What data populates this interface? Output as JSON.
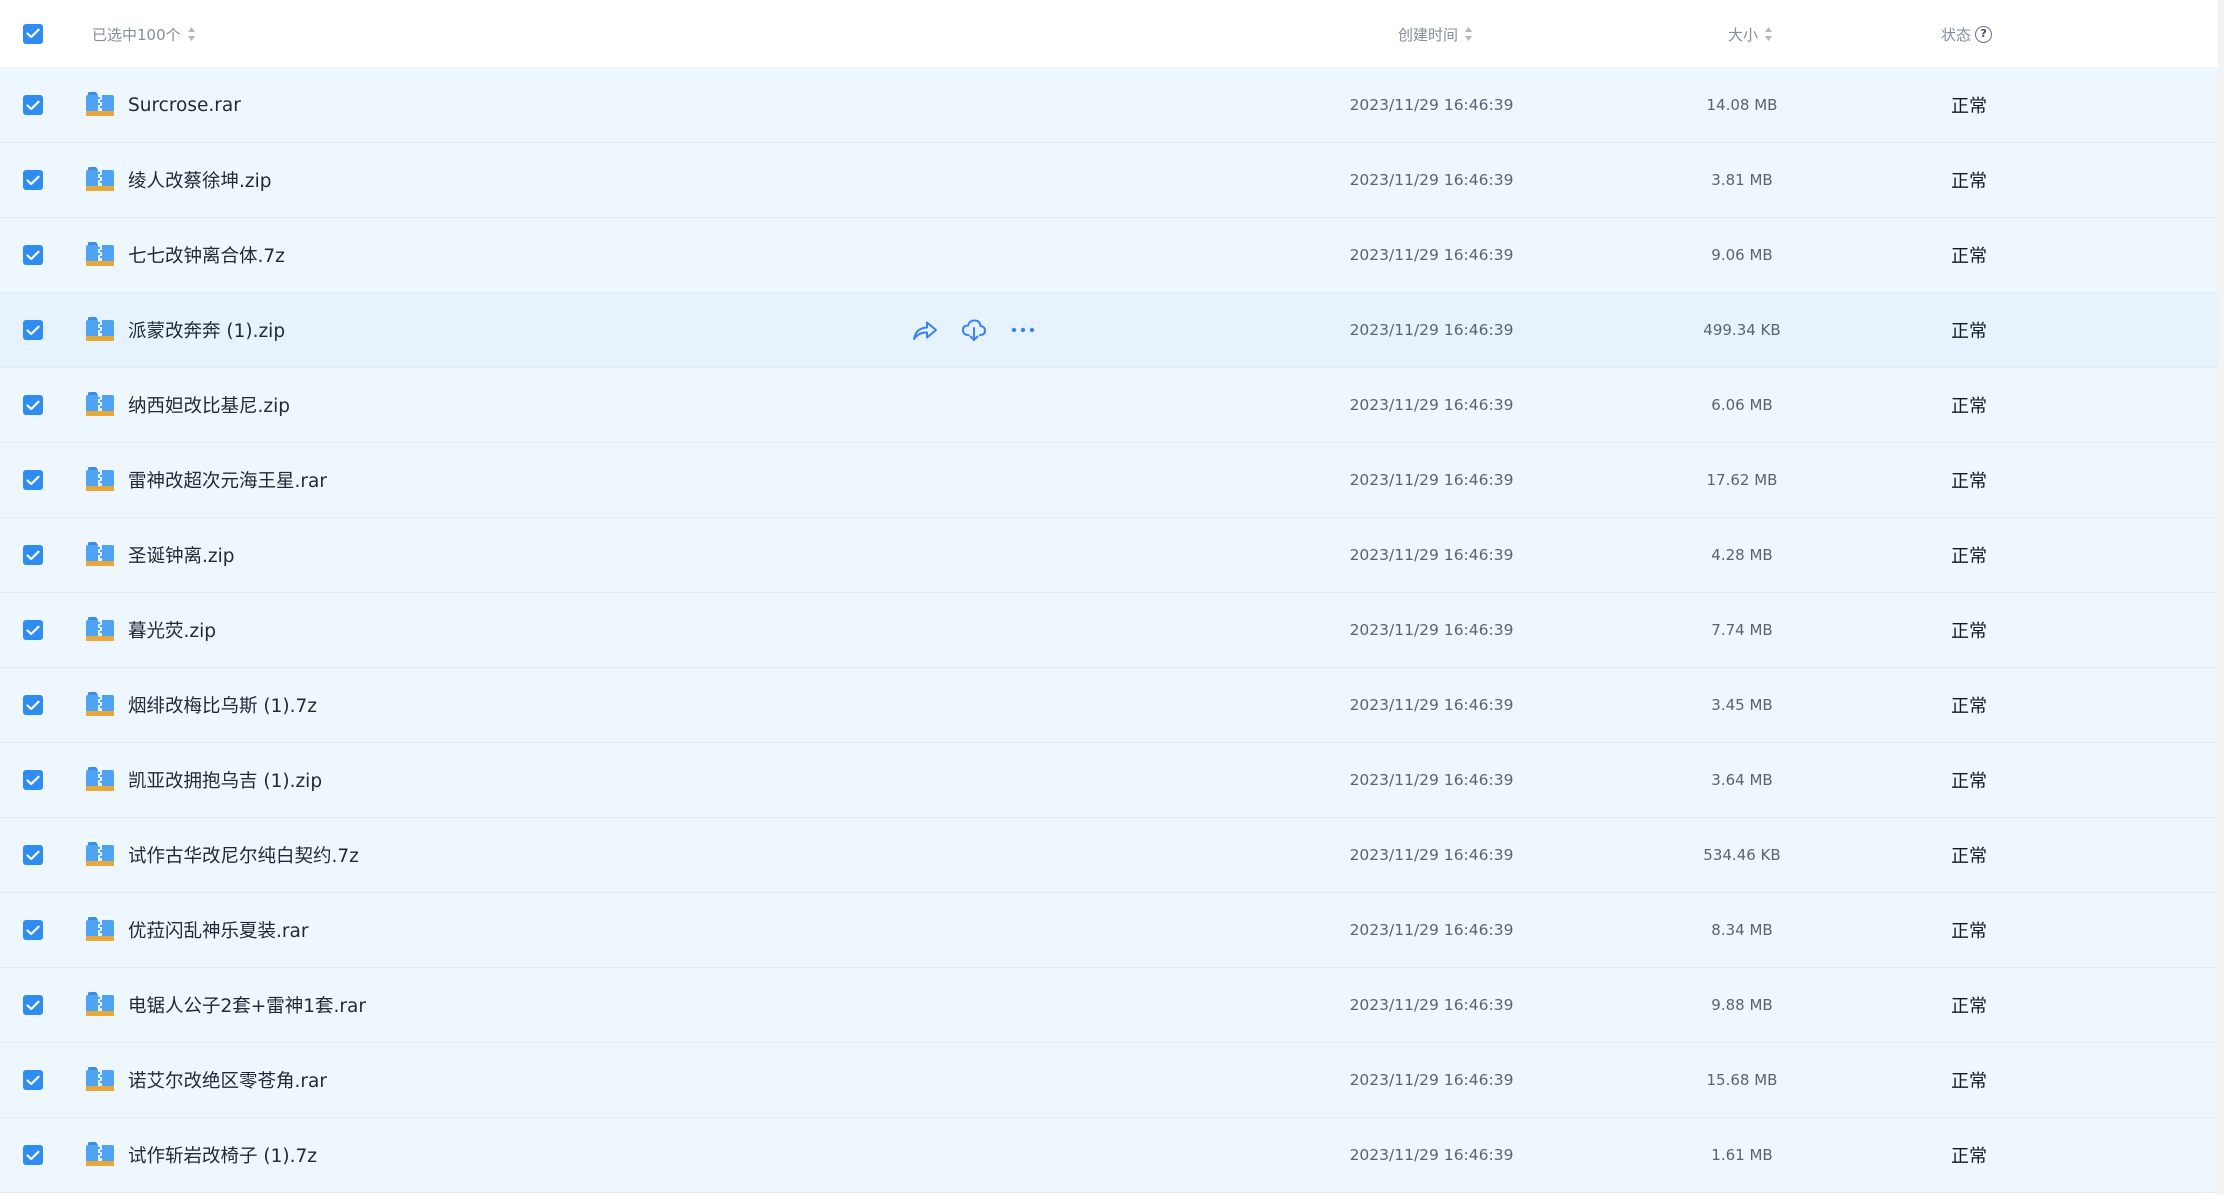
{
  "header": {
    "selected_label": "已选中100个",
    "date_label": "创建时间",
    "size_label": "大小",
    "status_label": "状态",
    "help_glyph": "?"
  },
  "colors": {
    "accent": "#2f8cf0",
    "row_bg": "#eff7fe",
    "row_hover_bg": "#e6f3fd"
  },
  "icons": {
    "file": "zip-archive-icon",
    "share": "share-icon",
    "download": "cloud-download-icon",
    "more": "more-dots-icon"
  },
  "files": [
    {
      "name": "Surcrose.rar",
      "date": "2023/11/29 16:46:39",
      "size": "14.08 MB",
      "status": "正常"
    },
    {
      "name": "绫人改蔡徐坤.zip",
      "date": "2023/11/29 16:46:39",
      "size": "3.81 MB",
      "status": "正常"
    },
    {
      "name": "七七改钟离合体.7z",
      "date": "2023/11/29 16:46:39",
      "size": "9.06 MB",
      "status": "正常"
    },
    {
      "name": "派蒙改奔奔 (1).zip",
      "date": "2023/11/29 16:46:39",
      "size": "499.34 KB",
      "status": "正常"
    },
    {
      "name": "纳西妲改比基尼.zip",
      "date": "2023/11/29 16:46:39",
      "size": "6.06 MB",
      "status": "正常"
    },
    {
      "name": "雷神改超次元海王星.rar",
      "date": "2023/11/29 16:46:39",
      "size": "17.62 MB",
      "status": "正常"
    },
    {
      "name": "圣诞钟离.zip",
      "date": "2023/11/29 16:46:39",
      "size": "4.28 MB",
      "status": "正常"
    },
    {
      "name": "暮光荧.zip",
      "date": "2023/11/29 16:46:39",
      "size": "7.74 MB",
      "status": "正常"
    },
    {
      "name": "烟绯改梅比乌斯 (1).7z",
      "date": "2023/11/29 16:46:39",
      "size": "3.45 MB",
      "status": "正常"
    },
    {
      "name": "凯亚改拥抱乌吉 (1).zip",
      "date": "2023/11/29 16:46:39",
      "size": "3.64 MB",
      "status": "正常"
    },
    {
      "name": "试作古华改尼尔纯白契约.7z",
      "date": "2023/11/29 16:46:39",
      "size": "534.46 KB",
      "status": "正常"
    },
    {
      "name": "优菈闪乱神乐夏装.rar",
      "date": "2023/11/29 16:46:39",
      "size": "8.34 MB",
      "status": "正常"
    },
    {
      "name": "电锯人公子2套+雷神1套.rar",
      "date": "2023/11/29 16:46:39",
      "size": "9.88 MB",
      "status": "正常"
    },
    {
      "name": "诺艾尔改绝区零苍角.rar",
      "date": "2023/11/29 16:46:39",
      "size": "15.68 MB",
      "status": "正常"
    },
    {
      "name": "试作斩岩改椅子 (1).7z",
      "date": "2023/11/29 16:46:39",
      "size": "1.61 MB",
      "status": "正常"
    }
  ]
}
